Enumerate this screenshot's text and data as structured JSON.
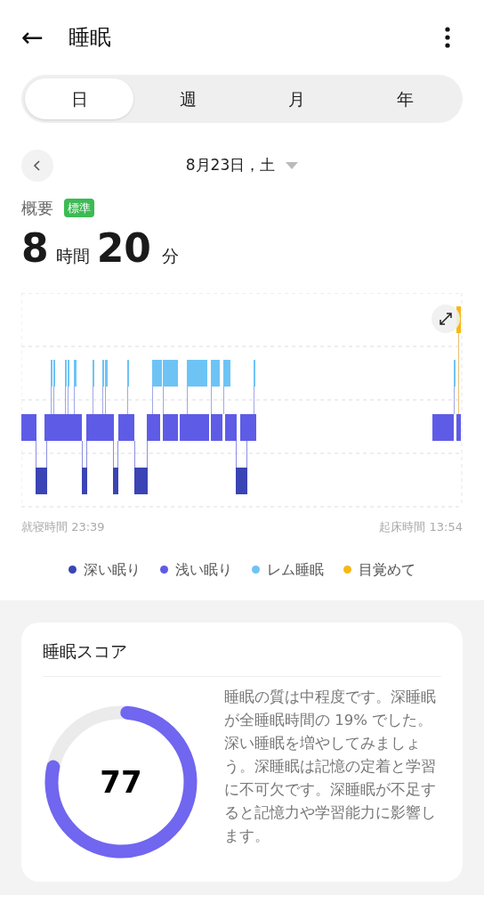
{
  "header": {
    "back_icon": "←",
    "title": "睡眠"
  },
  "tabs": [
    {
      "label": "日",
      "selected": true
    },
    {
      "label": "週",
      "selected": false
    },
    {
      "label": "月",
      "selected": false
    },
    {
      "label": "年",
      "selected": false
    }
  ],
  "date": {
    "label": "8月23日，土"
  },
  "overview": {
    "title": "概要",
    "badge": "標準",
    "hours": "8",
    "hours_unit": "時間",
    "minutes": "20",
    "minutes_unit": "分"
  },
  "chart": {
    "start_label": "就寝時間 23:39",
    "end_label": "起床時間 13:54"
  },
  "legend": [
    {
      "label": "深い眠り",
      "color": "#3a44b4"
    },
    {
      "label": "浅い眠り",
      "color": "#5e5ce6"
    },
    {
      "label": "レム睡眠",
      "color": "#6ec3f5"
    },
    {
      "label": "目覚めて",
      "color": "#f5b915"
    }
  ],
  "score_card": {
    "title": "睡眠スコア",
    "score": "77",
    "level": 0.77,
    "description": "睡眠の質は中程度です。深睡眠が全睡眠時間の 19% でした。深い睡眠を増やしてみましょう。深睡眠は記憶の定着と学習に不可欠です。深睡眠が不足すると記憶力や学習能力に影響します。"
  }
}
